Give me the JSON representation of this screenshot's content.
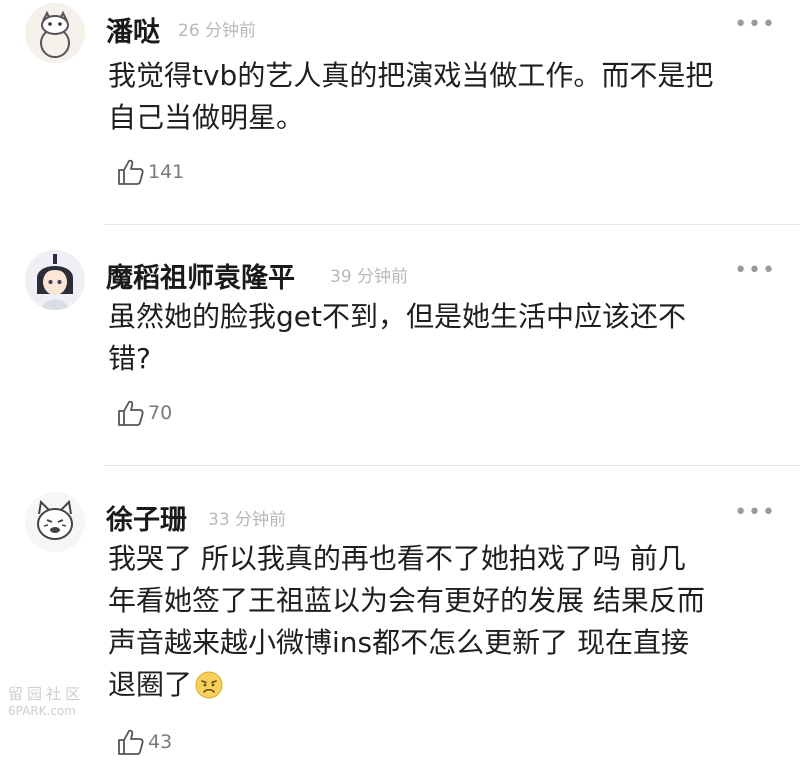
{
  "comments": [
    {
      "username": "潘哒",
      "time": "26 分钟前",
      "lines": [
        "我觉得tvb的艺人真的把演戏当做工作。而不是把",
        "自己当做明星。"
      ],
      "likes": "141",
      "avatar_icon": "cartoon-cat-avatar"
    },
    {
      "username": "魔稻祖师袁隆平",
      "time": "39 分钟前",
      "lines": [
        "虽然她的脸我get不到，但是她生活中应该还不",
        "错?"
      ],
      "likes": "70",
      "avatar_icon": "anime-character-avatar"
    },
    {
      "username": "徐子珊",
      "time": "33 分钟前",
      "lines": [
        "我哭了  所以我真的再也看不了她拍戏了吗  前几",
        "年看她签了王祖蓝以为会有更好的发展  结果反而",
        "声音越来越小微博ins都不怎么更新了  现在直接",
        "退圈了"
      ],
      "likes": "43",
      "avatar_icon": "meme-face-avatar",
      "trailing_emoji": "sad-face-emoji"
    }
  ],
  "more_label": "•••",
  "watermark": {
    "line1": "留园社区",
    "line2": "6PARK.com"
  }
}
